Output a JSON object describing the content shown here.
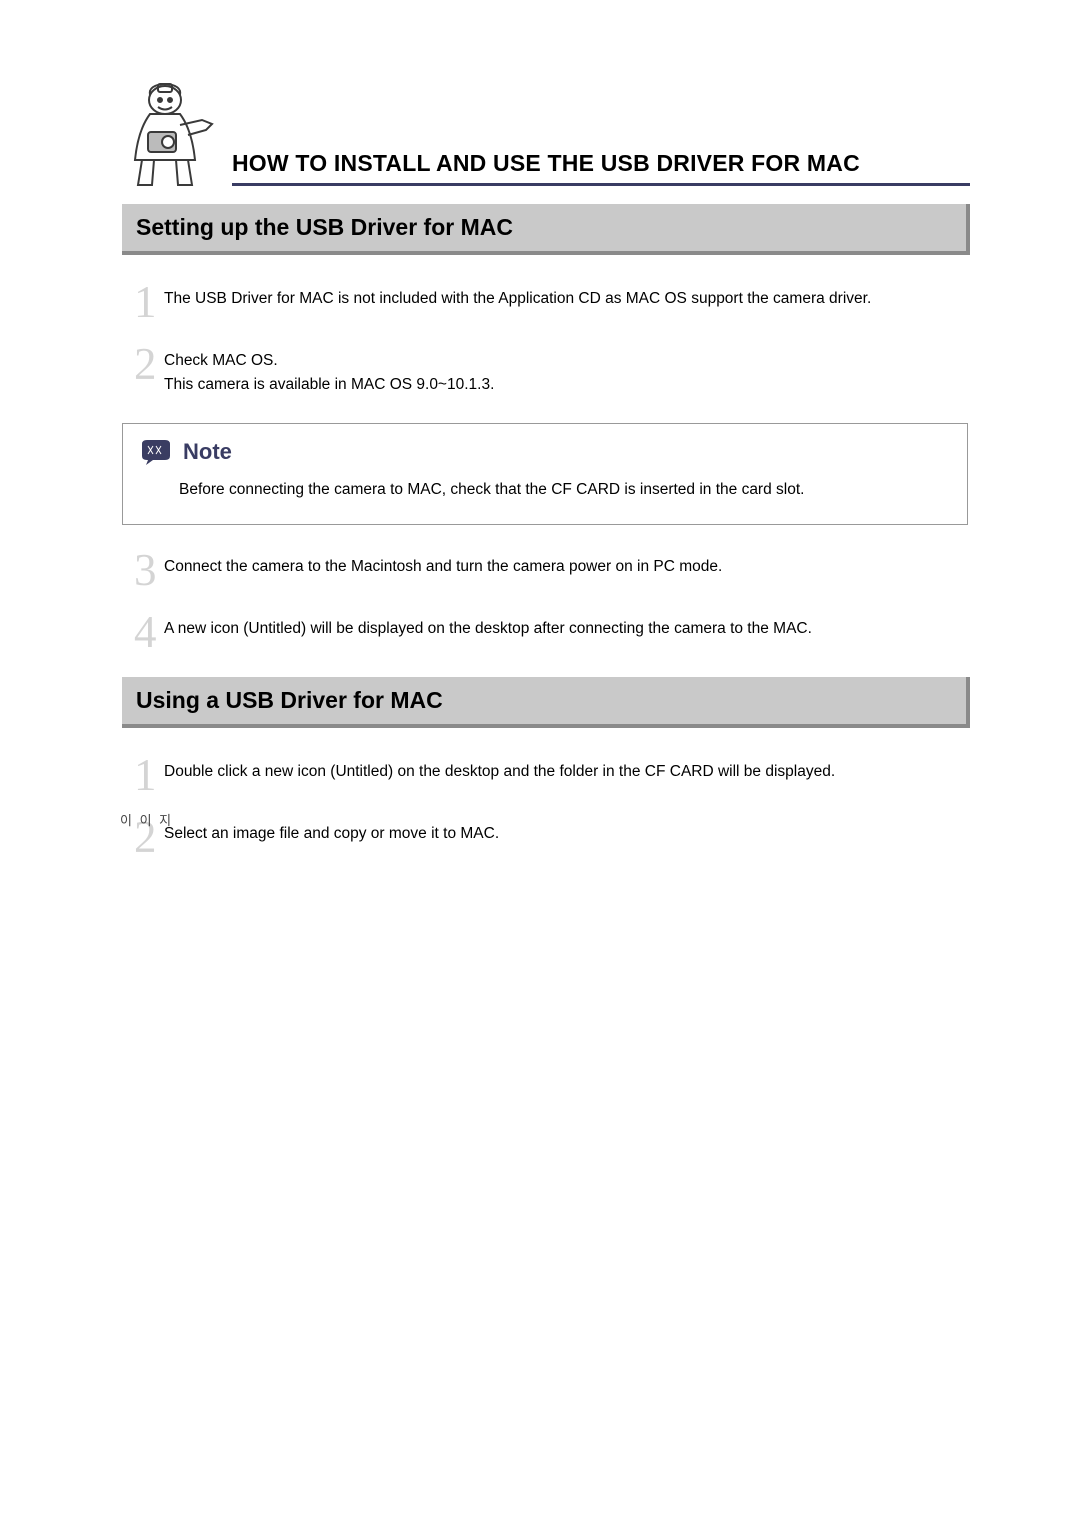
{
  "header": {
    "title": "HOW TO INSTALL AND USE THE USB DRIVER FOR MAC"
  },
  "section1": {
    "title": "Setting up the USB Driver for MAC",
    "steps": {
      "s1": {
        "num": "1",
        "text": "The USB Driver for MAC is not included with the Application CD as MAC OS support the camera driver."
      },
      "s2a": {
        "num": "2",
        "line1": "Check MAC OS.",
        "line2": "This camera is available in MAC OS 9.0~10.1.3."
      },
      "s3": {
        "num": "3",
        "text": "Connect the camera to the Macintosh and turn the camera power on in PC mode."
      },
      "s4": {
        "num": "4",
        "text": "A new icon (Untitled) will be displayed on the desktop after connecting the camera to the MAC."
      }
    }
  },
  "note": {
    "title": "Note",
    "body": "Before connecting the camera to MAC, check that the CF CARD is inserted in the card slot."
  },
  "section2": {
    "title": "Using a USB Driver for MAC",
    "steps": {
      "s1": {
        "num": "1",
        "text": "Double click a new icon (Untitled) on the desktop and the folder in the CF CARD will be displayed."
      },
      "s2": {
        "num": "2",
        "text": "Select an image file and copy or move it to MAC."
      }
    }
  },
  "footer": {
    "marker": "이 이 지"
  }
}
